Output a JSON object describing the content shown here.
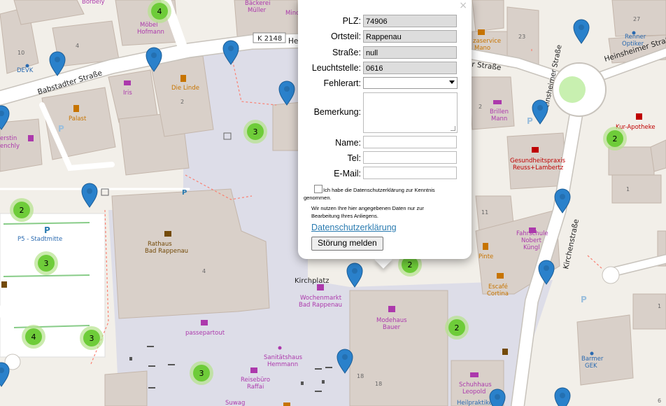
{
  "map": {
    "street_labels": {
      "k2148": "K 2148",
      "babstadter": "Babstadter Straße",
      "heinsheimer_right": "Heinsheimer Straße",
      "heinsheimer_round": "Heinsheimer Straße",
      "heinsheimer_top_partial": "Hei",
      "strasse_partial": "r Straße",
      "kirchenstrasse": "Kirchenstraße"
    },
    "poi_labels": {
      "borbely": "Borbely",
      "baeckerei": "Bäckerei",
      "mueller": "Müller",
      "mino": "Mino",
      "moebel": "Möbel",
      "hofmann": "Hofmann",
      "devk": "DEVK",
      "iris": "Iris",
      "die_linde": "Die Linde",
      "palast": "Palast",
      "kerstin": "erstin",
      "enchly": "enchly",
      "p5": "P5 - Stadtmitte",
      "rathaus1": "Rathaus",
      "rathaus2": "Bad Rappenau",
      "kirchplatz": "Kirchplatz",
      "wochenmarkt1": "Wochenmarkt",
      "wochenmarkt2": "Bad Rappenau",
      "passepartout": "passepartout",
      "modehaus1": "Modehaus",
      "modehaus2": "Bauer",
      "sanitaetshaus1": "Sanitätshaus",
      "sanitaetshaus2": "Hemmann",
      "reiseburo1": "Reisebüro",
      "reiseburo2": "Raffai",
      "suwag": "Suwag",
      "pizzaservice1": "zaservice",
      "pizzaservice2": "Mano",
      "renner": "Renner",
      "optiker": "Optiker",
      "brillen1": "Brillen",
      "brillen2": "Mann",
      "kur_apotheke": "Kur-Apotheke",
      "praxis1": "Gesundheitspraxis",
      "praxis2": "Reuss+Lambertz",
      "fahrschule1": "Fahrschule",
      "fahrschule2": "Nobert",
      "fahrschule3": "Küngl",
      "pinte": "Pinte",
      "escafe1": "Escafé",
      "escafe2": "Cortina",
      "barmer1": "Barmer",
      "barmer2": "GEK",
      "schuhhaus1": "Schuhhaus",
      "schuhhaus2": "Leopold",
      "heilpraktiker": "Heilpraktiker"
    },
    "house_numbers": [
      "10",
      "4",
      "2",
      "27",
      "23",
      "2",
      "1",
      "11",
      "4",
      "18",
      "18",
      "1",
      "6"
    ],
    "parking_letter": "P",
    "clusters": [
      "4",
      "3",
      "2",
      "3",
      "4",
      "3",
      "3",
      "2",
      "2",
      "2"
    ],
    "colors": {
      "marker": "#2a81cb",
      "cluster": "#6ecc39",
      "cluster_halo": "#b5e28c",
      "poi": "#ac39ac",
      "road": "#ffffff",
      "building": "#d9d0c9",
      "pedestrian": "#dddde8"
    }
  },
  "popup": {
    "close": "×",
    "plz_label": "PLZ:",
    "plz_value": "74906",
    "ortsteil_label": "Ortsteil:",
    "ortsteil_value": "Rappenau",
    "strasse_label": "Straße:",
    "strasse_value": "null",
    "leuchtstelle_label": "Leuchtstelle:",
    "leuchtstelle_value": "0616",
    "fehlerart_label": "Fehlerart:",
    "fehlerart_value": "",
    "bemerkung_label": "Bemerkung:",
    "name_label": "Name:",
    "tel_label": "Tel:",
    "email_label": "E-Mail:",
    "consent_line1": "Ich habe die Datenschutzerklärung zur Kenntnis",
    "consent_line2": "genommen.",
    "note_line1": "Wir nutzen Ihre hier angegebenen Daten nur zur",
    "note_line2": "Bearbeitung Ihres Anliegens.",
    "privacy_link": "Datenschutzerklärung",
    "submit": "Störung melden"
  }
}
